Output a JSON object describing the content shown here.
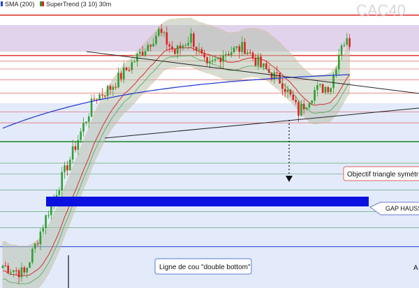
{
  "legend": {
    "items": [
      {
        "label": "SMA (200)",
        "color": "#1f3fd0"
      },
      {
        "label": "SuperTrend (3 10) 30m",
        "color": "#2e9a2e",
        "color2": "#e02020"
      }
    ]
  },
  "watermark": "CAC40",
  "annotations": {
    "objectif": "Objectif triangle symétri",
    "gap": "GAP HAUSS",
    "neckline": "Ligne de cou \"double bottom\"",
    "corner": "A"
  },
  "colors": {
    "background": "#ffffff",
    "lower_band": "#dfe8fa",
    "purple_zone": "#d8c4e8",
    "gap_bar": "#0a10e0",
    "up_candle": "#2ea02e",
    "down_candle": "#e02020",
    "sma": "#2a3fd0",
    "envelope_fill": "#b8c2b0"
  },
  "chart_data": {
    "type": "candlestick",
    "title": "CAC40",
    "series": [
      {
        "name": "SMA (200)",
        "role": "moving-average"
      },
      {
        "name": "SuperTrend (3 10) 30m",
        "role": "trend-stop"
      }
    ],
    "price_trend_steps": [
      {
        "bar": 0,
        "level": 0.05
      },
      {
        "bar": 8,
        "level": 0.02
      },
      {
        "bar": 18,
        "level": 0.28
      },
      {
        "bar": 26,
        "level": 0.47
      },
      {
        "bar": 34,
        "level": 0.67
      },
      {
        "bar": 40,
        "level": 0.71
      },
      {
        "bar": 48,
        "level": 0.8
      },
      {
        "bar": 58,
        "level": 0.92
      },
      {
        "bar": 64,
        "level": 0.84
      },
      {
        "bar": 70,
        "level": 0.9
      },
      {
        "bar": 76,
        "level": 0.78
      },
      {
        "bar": 82,
        "level": 0.84
      },
      {
        "bar": 90,
        "level": 0.86
      },
      {
        "bar": 96,
        "level": 0.79
      },
      {
        "bar": 104,
        "level": 0.73
      },
      {
        "bar": 110,
        "level": 0.62
      },
      {
        "bar": 116,
        "level": 0.7
      },
      {
        "bar": 122,
        "level": 0.72
      },
      {
        "bar": 126,
        "level": 0.88
      }
    ],
    "horizontal_levels": {
      "red": [
        0.98,
        0.83,
        0.81,
        0.78,
        0.74,
        0.69,
        0.62,
        0.58
      ],
      "green": [
        0.51,
        0.43,
        0.39,
        0.33,
        0.25,
        0.19
      ],
      "blue": [
        0.12
      ]
    },
    "bars": 130,
    "grid": false
  }
}
